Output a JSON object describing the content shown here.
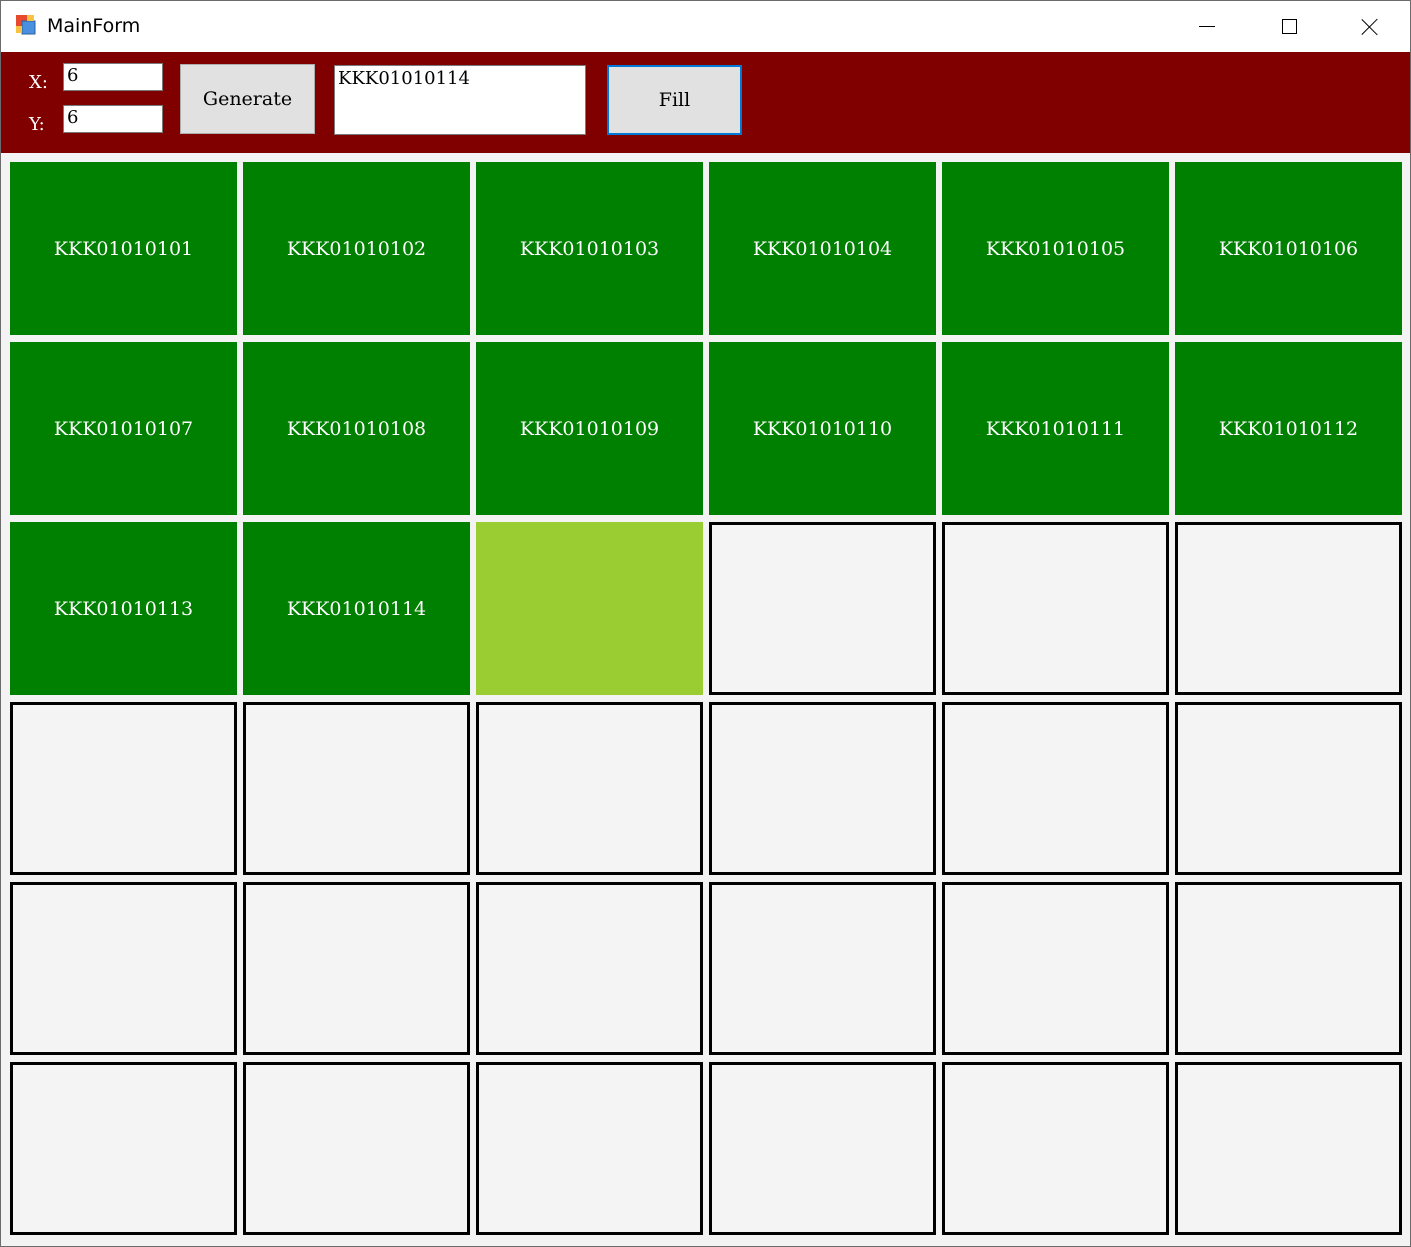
{
  "window": {
    "title": "MainForm",
    "icon": "app-window-icon",
    "controls": [
      "minimize-icon",
      "maximize-icon",
      "close-icon"
    ]
  },
  "toolbar": {
    "x_label": "X:",
    "x_value": "6",
    "y_label": "Y:",
    "y_value": "6",
    "generate_label": "Generate",
    "code_value": "KKK01010114",
    "fill_label": "Fill"
  },
  "colors": {
    "toolbar_bg": "#800000",
    "filled_cell": "#008000",
    "current_cell": "#9ACD32",
    "empty_cell": "#F4F4F4",
    "focus_border": "#0078D7"
  },
  "grid": {
    "columns": 6,
    "rows": 6,
    "cells": [
      {
        "label": "KKK01010101",
        "state": "filled"
      },
      {
        "label": "KKK01010102",
        "state": "filled"
      },
      {
        "label": "KKK01010103",
        "state": "filled"
      },
      {
        "label": "KKK01010104",
        "state": "filled"
      },
      {
        "label": "KKK01010105",
        "state": "filled"
      },
      {
        "label": "KKK01010106",
        "state": "filled"
      },
      {
        "label": "KKK01010107",
        "state": "filled"
      },
      {
        "label": "KKK01010108",
        "state": "filled"
      },
      {
        "label": "KKK01010109",
        "state": "filled"
      },
      {
        "label": "KKK01010110",
        "state": "filled"
      },
      {
        "label": "KKK01010111",
        "state": "filled"
      },
      {
        "label": "KKK01010112",
        "state": "filled"
      },
      {
        "label": "KKK01010113",
        "state": "filled"
      },
      {
        "label": "KKK01010114",
        "state": "filled"
      },
      {
        "label": "",
        "state": "current"
      },
      {
        "label": "",
        "state": "empty"
      },
      {
        "label": "",
        "state": "empty"
      },
      {
        "label": "",
        "state": "empty"
      },
      {
        "label": "",
        "state": "empty"
      },
      {
        "label": "",
        "state": "empty"
      },
      {
        "label": "",
        "state": "empty"
      },
      {
        "label": "",
        "state": "empty"
      },
      {
        "label": "",
        "state": "empty"
      },
      {
        "label": "",
        "state": "empty"
      },
      {
        "label": "",
        "state": "empty"
      },
      {
        "label": "",
        "state": "empty"
      },
      {
        "label": "",
        "state": "empty"
      },
      {
        "label": "",
        "state": "empty"
      },
      {
        "label": "",
        "state": "empty"
      },
      {
        "label": "",
        "state": "empty"
      },
      {
        "label": "",
        "state": "empty"
      },
      {
        "label": "",
        "state": "empty"
      },
      {
        "label": "",
        "state": "empty"
      },
      {
        "label": "",
        "state": "empty"
      },
      {
        "label": "",
        "state": "empty"
      },
      {
        "label": "",
        "state": "empty"
      }
    ]
  }
}
